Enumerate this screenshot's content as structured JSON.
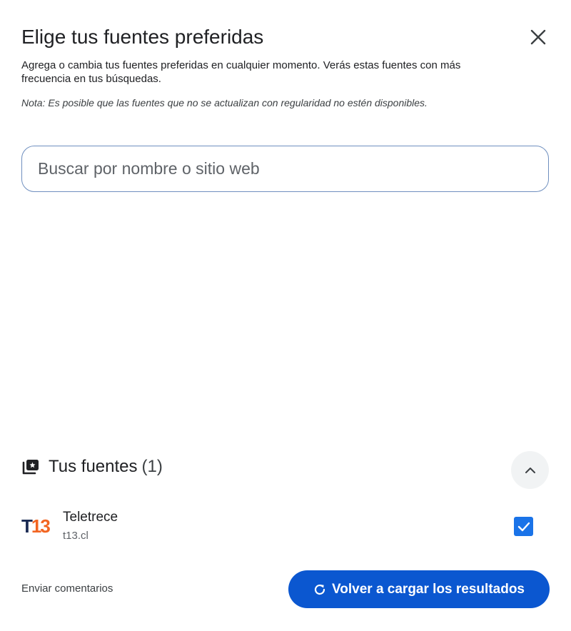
{
  "dialog": {
    "title": "Elige tus fuentes preferidas",
    "description": "Agrega o cambia tus fuentes preferidas en cualquier momento. Verás estas fuentes con más frecuencia en tus búsquedas.",
    "note": "Nota: Es posible que las fuentes que no se actualizan con regularidad no estén disponibles."
  },
  "search": {
    "placeholder": "Buscar por nombre o sitio web",
    "value": ""
  },
  "sources_section": {
    "title": "Tus fuentes",
    "count": "(1)",
    "items": [
      {
        "logo_part1": "T",
        "logo_part2": "13",
        "name": "Teletrece",
        "domain": "t13.cl",
        "checked": true
      }
    ]
  },
  "footer": {
    "feedback_label": "Enviar comentarios",
    "reload_label": "Volver a cargar los resultados"
  },
  "colors": {
    "primary_button": "#0b57d0",
    "checkbox": "#1a73e8",
    "logo_dark": "#1a2a52",
    "logo_orange": "#f26522"
  }
}
